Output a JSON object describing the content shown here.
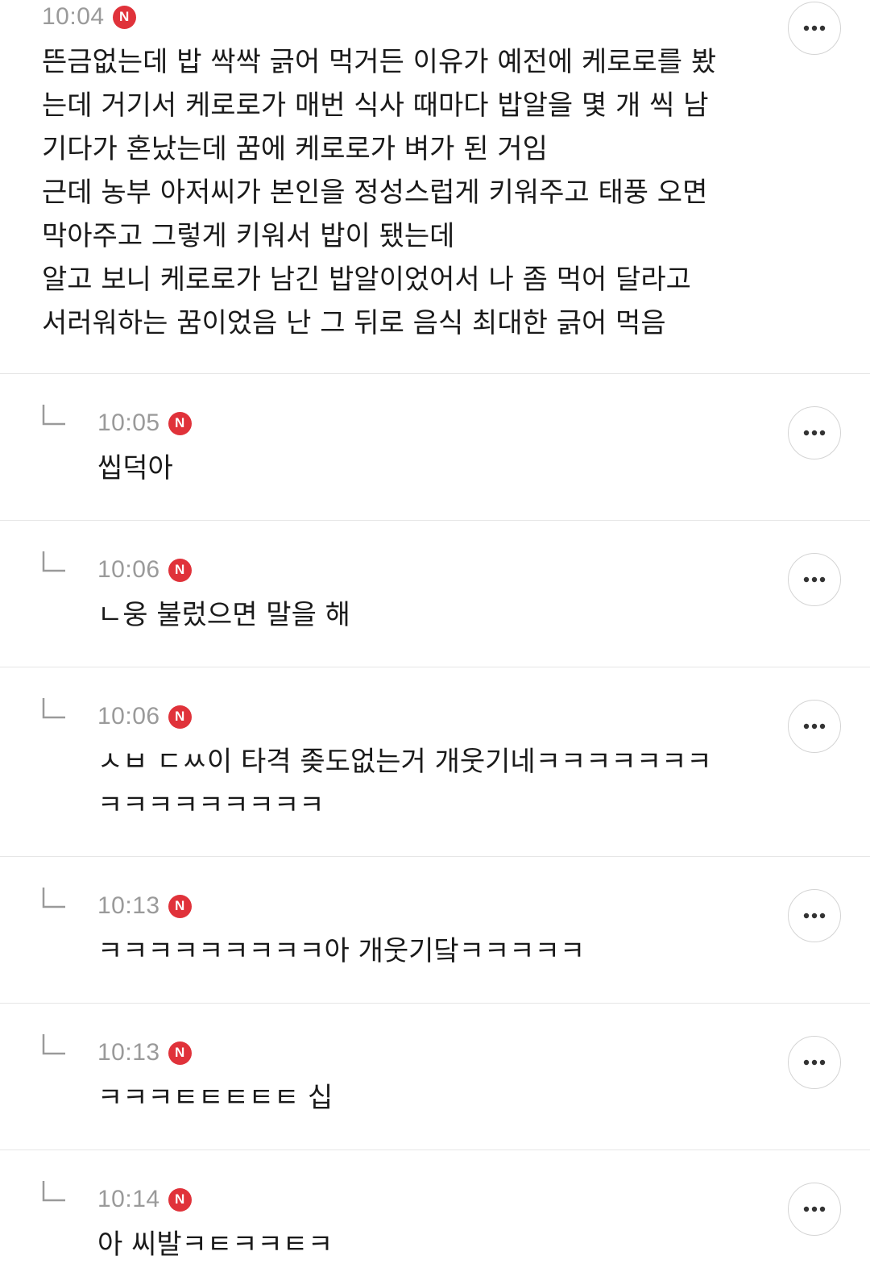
{
  "comments": [
    {
      "time": "10:04",
      "badge": "N",
      "lines": [
        "뜬금없는데 밥 싹싹 긁어 먹거든 이유가 예전에 케로로를 봤",
        "는데 거기서 케로로가 매번 식사 때마다 밥알을 몇 개 씩 남",
        "기다가 혼났는데 꿈에 케로로가 벼가 된 거임",
        "근데 농부 아저씨가 본인을 정성스럽게 키워주고 태풍 오면",
        "막아주고 그렇게 키워서 밥이 됐는데",
        "알고 보니 케로로가 남긴 밥알이었어서 나 좀 먹어 달라고",
        "서러워하는 꿈이었음 난 그 뒤로 음식 최대한 긁어 먹음"
      ]
    },
    {
      "time": "10:05",
      "badge": "N",
      "lines": [
        "씹덕아"
      ]
    },
    {
      "time": "10:06",
      "badge": "N",
      "lines": [
        "ㄴ웅 불렀으면 말을 해"
      ]
    },
    {
      "time": "10:06",
      "badge": "N",
      "lines": [
        "ㅅㅂ ㄷㅆ이 타격 좆도없는거 개웃기네ㅋㅋㅋㅋㅋㅋㅋ",
        "ㅋㅋㅋㅋㅋㅋㅋㅋㅋ"
      ]
    },
    {
      "time": "10:13",
      "badge": "N",
      "lines": [
        "ㅋㅋㅋㅋㅋㅋㅋㅋㅋ아 개웃기닼ㅋㅋㅋㅋㅋ"
      ]
    },
    {
      "time": "10:13",
      "badge": "N",
      "lines": [
        "ㅋㅋㅋㅌㅌㅌㅌㅌ 십"
      ]
    },
    {
      "time": "10:14",
      "badge": "N",
      "lines": [
        "아 씨발ㅋㅌㅋㅋㅌㅋ"
      ]
    }
  ]
}
